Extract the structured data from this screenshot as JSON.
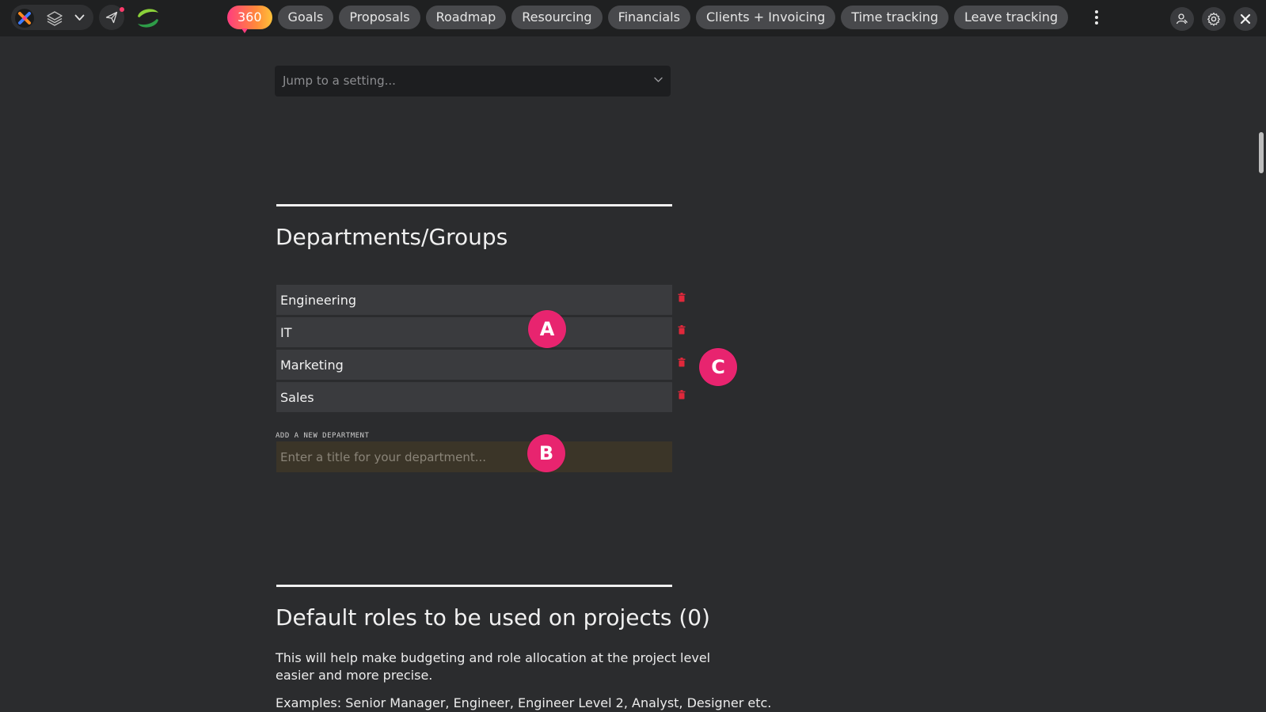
{
  "topbar": {
    "nav": [
      {
        "label": "360",
        "highlight": true
      },
      {
        "label": "Goals"
      },
      {
        "label": "Proposals"
      },
      {
        "label": "Roadmap"
      },
      {
        "label": "Resourcing"
      },
      {
        "label": "Financials"
      },
      {
        "label": "Clients + Invoicing"
      },
      {
        "label": "Time tracking"
      },
      {
        "label": "Leave tracking"
      }
    ],
    "left_icons": [
      "app-logo-icon",
      "layers-icon",
      "chevron-down-icon",
      "send-icon",
      "brand-logo-icon"
    ],
    "right_icons": [
      "user-switch-icon",
      "gear-icon",
      "close-icon"
    ],
    "colors": {
      "accent_gradient_start": "#ff3d7f",
      "accent_gradient_end": "#ffc23a",
      "notification": "#ff3b6b"
    }
  },
  "jump": {
    "placeholder": "Jump to a setting..."
  },
  "departments": {
    "title": "Departments/Groups",
    "items": [
      {
        "label": "Engineering"
      },
      {
        "label": "IT"
      },
      {
        "label": "Marketing"
      },
      {
        "label": "Sales"
      }
    ],
    "add_label": "ADD A NEW DEPARTMENT",
    "add_placeholder": "Enter a title for your department...",
    "delete_icon": "trash-icon",
    "delete_color": "#e0283b"
  },
  "annotations": {
    "a": "A",
    "b": "B",
    "c": "C",
    "color": "#e8246f"
  },
  "roles": {
    "title": "Default roles to be used on projects (0)",
    "description": "This will help make budgeting and role allocation at the project level easier and more precise.",
    "examples": "Examples: Senior Manager, Engineer, Engineer Level 2, Analyst, Designer etc."
  }
}
